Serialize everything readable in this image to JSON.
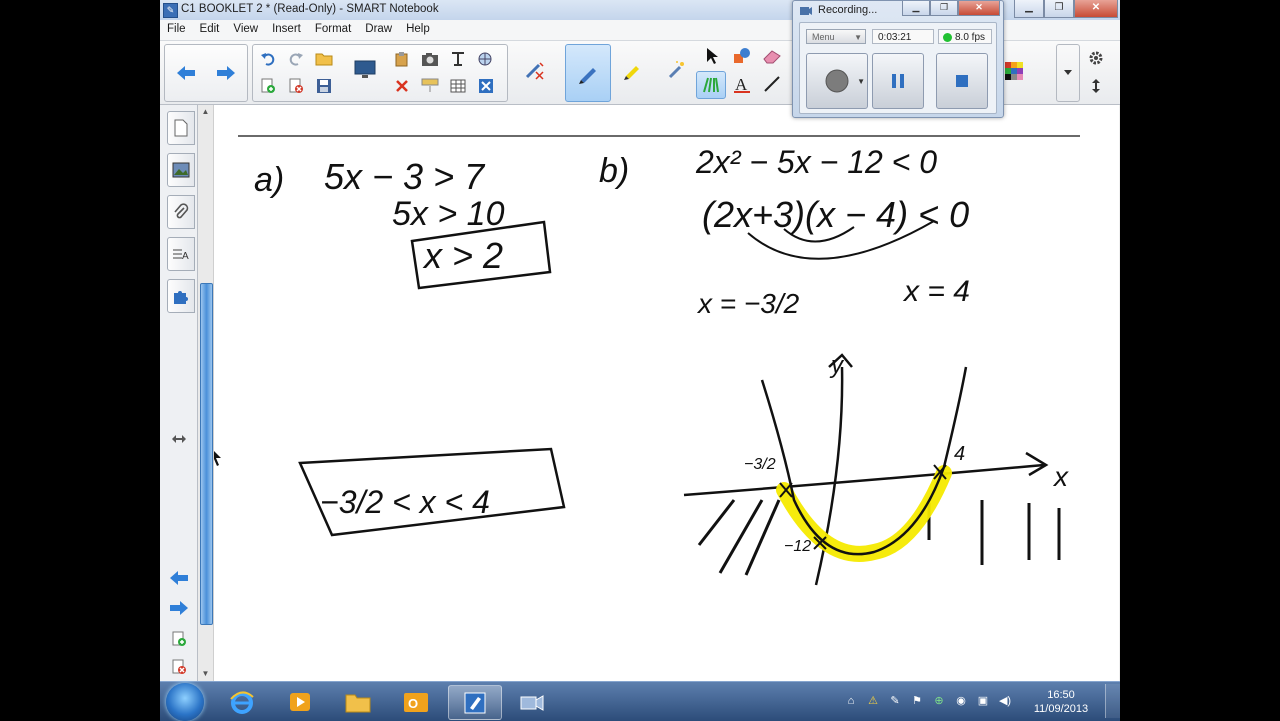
{
  "window": {
    "title": "C1 BOOKLET 2 * (Read-Only) - SMART Notebook"
  },
  "menubar": [
    "File",
    "Edit",
    "View",
    "Insert",
    "Format",
    "Draw",
    "Help"
  ],
  "recorder": {
    "title": "Recording...",
    "menu_label": "Menu",
    "elapsed": "0:03:21",
    "fps": "8.0 fps",
    "status_color": "#21c132"
  },
  "work": {
    "part_a": [
      "a)",
      "5x − 3 > 7",
      "5x > 10",
      "x > 2"
    ],
    "part_b": [
      "b)",
      "2x² − 5x − 12 < 0",
      "(2x+3)(x − 4) < 0",
      "x = −3/2",
      "x = 4"
    ],
    "answer": "−3/2 < x < 4",
    "graph": {
      "x_label": "x",
      "y_label": "y",
      "root_left": "−3/2",
      "root_right": "4",
      "intercept": "−12"
    }
  },
  "taskbar": {
    "time": "16:50",
    "date": "11/09/2013"
  },
  "colors": {
    "highlight": "#f6ea00",
    "accent": "#4a90d9"
  }
}
